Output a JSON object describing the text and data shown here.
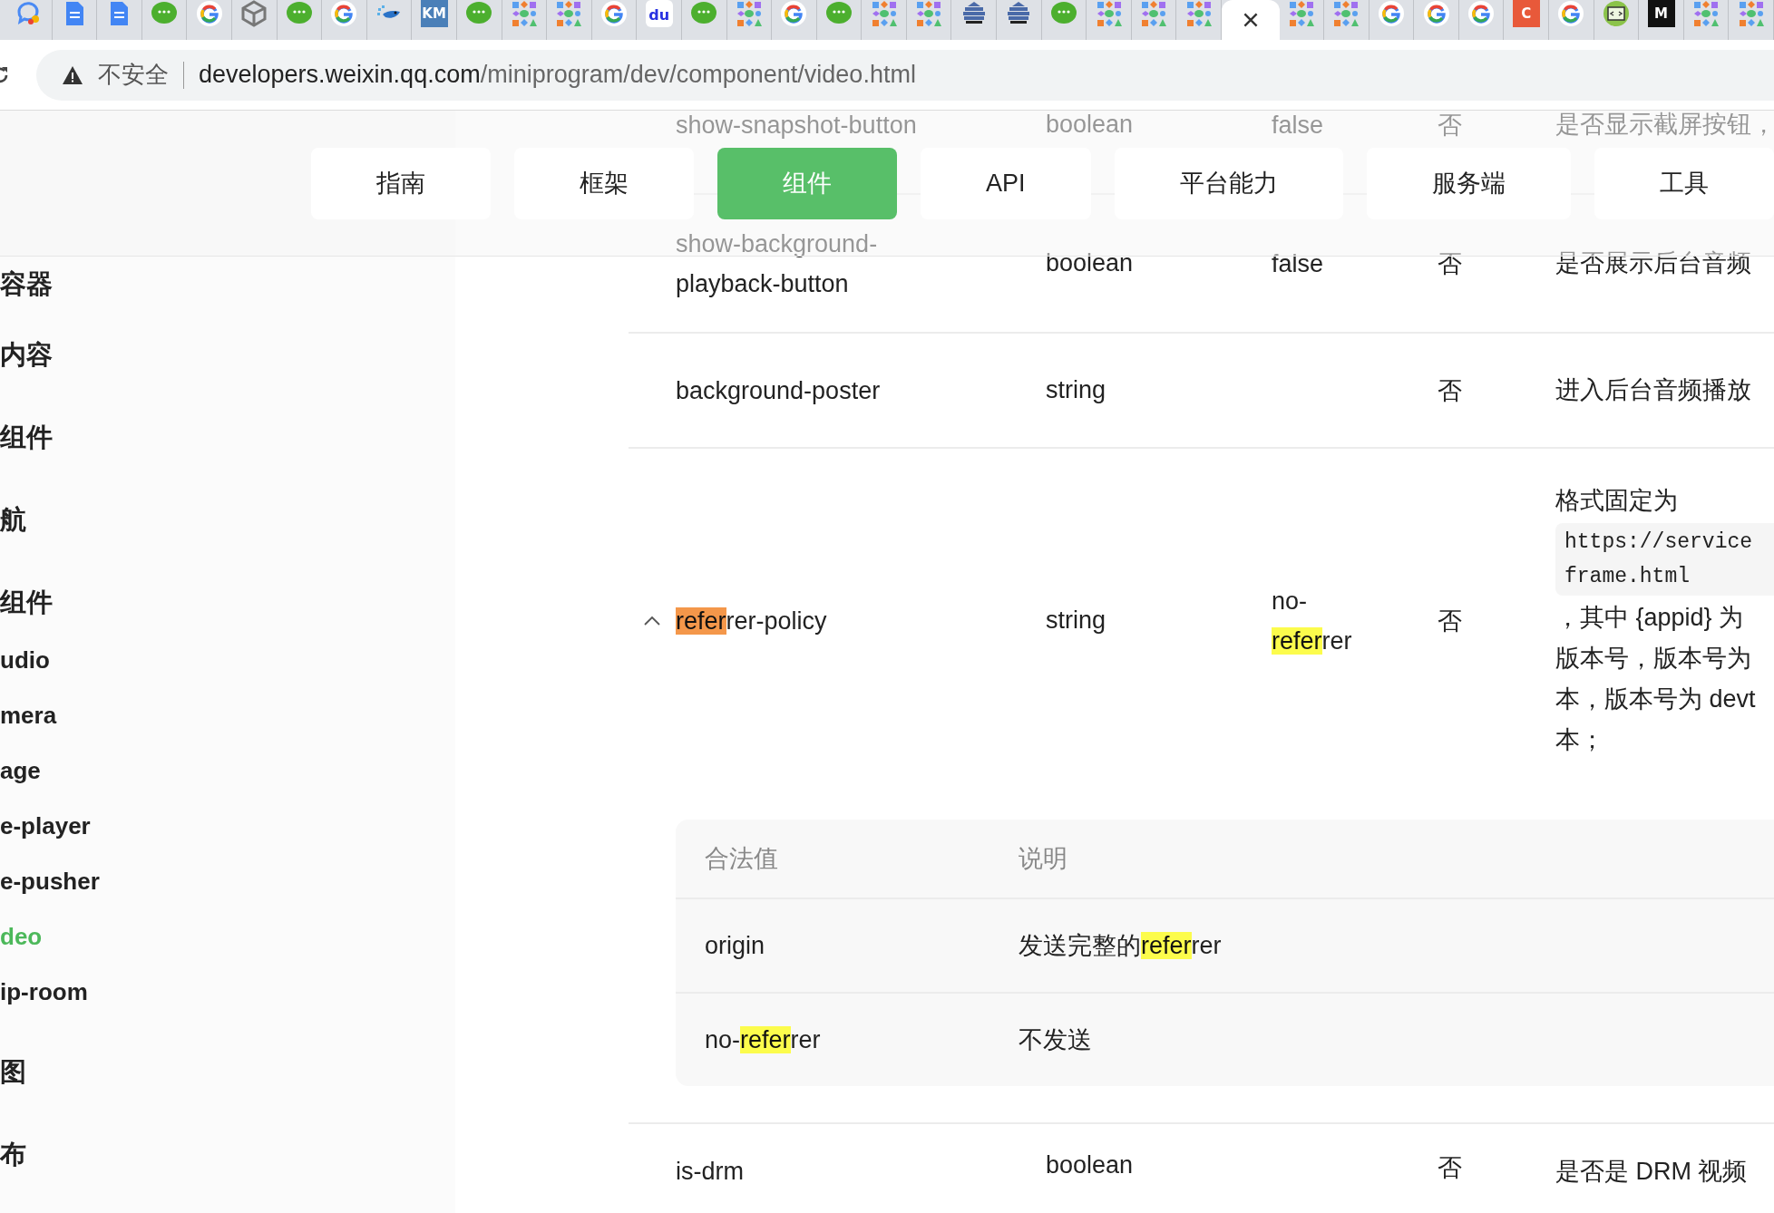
{
  "browser": {
    "tabs": [
      {
        "kind": "chat",
        "selected": false
      },
      {
        "kind": "doc",
        "selected": false
      },
      {
        "kind": "doc",
        "selected": false
      },
      {
        "kind": "wechat",
        "selected": false
      },
      {
        "kind": "google",
        "selected": false
      },
      {
        "kind": "cube",
        "selected": false
      },
      {
        "kind": "wechat",
        "selected": false
      },
      {
        "kind": "google",
        "selected": false
      },
      {
        "kind": "bird",
        "selected": false
      },
      {
        "kind": "tile",
        "mark": "KM",
        "color": "#4a7fb8",
        "selected": false
      },
      {
        "kind": "wechat",
        "selected": false
      },
      {
        "kind": "shapes",
        "selected": false
      },
      {
        "kind": "shapes",
        "selected": false
      },
      {
        "kind": "google",
        "selected": false
      },
      {
        "kind": "paw",
        "mark": "du",
        "selected": false
      },
      {
        "kind": "wechat",
        "selected": false
      },
      {
        "kind": "shapes",
        "selected": false
      },
      {
        "kind": "google",
        "selected": false
      },
      {
        "kind": "wechat",
        "selected": false
      },
      {
        "kind": "shapes",
        "selected": false
      },
      {
        "kind": "shapes",
        "selected": false
      },
      {
        "kind": "stack",
        "selected": false
      },
      {
        "kind": "stack",
        "selected": false
      },
      {
        "kind": "wechat",
        "selected": false
      },
      {
        "kind": "shapes",
        "selected": false
      },
      {
        "kind": "shapes",
        "selected": false
      },
      {
        "kind": "shapes",
        "selected": false
      },
      {
        "selected": true
      },
      {
        "kind": "shapes",
        "selected": false
      },
      {
        "kind": "shapes",
        "selected": false
      },
      {
        "kind": "google",
        "selected": false
      },
      {
        "kind": "google",
        "selected": false
      },
      {
        "kind": "google",
        "selected": false
      },
      {
        "kind": "tile",
        "mark": "C",
        "color": "#e8593a",
        "selected": false
      },
      {
        "kind": "google",
        "selected": false
      },
      {
        "kind": "code",
        "selected": false
      },
      {
        "kind": "tile",
        "mark": "M",
        "color": "#111111",
        "selected": false
      },
      {
        "kind": "shapes",
        "selected": false
      },
      {
        "kind": "shapes",
        "selected": false
      }
    ],
    "address": {
      "security": "不安全",
      "host": "developers.weixin.qq.com",
      "path": "/miniprogram/dev/component/video.html"
    }
  },
  "nav": [
    {
      "label": "指南",
      "selected": false
    },
    {
      "label": "框架",
      "selected": false
    },
    {
      "label": "组件",
      "selected": true
    },
    {
      "label": "API",
      "selected": false
    },
    {
      "label": "平台能力",
      "selected": false
    },
    {
      "label": "服务端",
      "selected": false
    },
    {
      "label": "工具",
      "selected": false
    }
  ],
  "sidebar": {
    "items": [
      {
        "label": "容器",
        "kind": "section",
        "selected": false
      },
      {
        "label": "内容",
        "kind": "section",
        "selected": false
      },
      {
        "label": "组件",
        "kind": "section",
        "selected": false
      },
      {
        "label": "航",
        "kind": "section",
        "selected": false
      },
      {
        "label": "组件",
        "kind": "section",
        "selected": false
      },
      {
        "label": "udio",
        "kind": "item",
        "selected": false
      },
      {
        "label": "mera",
        "kind": "item",
        "selected": false
      },
      {
        "label": "age",
        "kind": "item",
        "selected": false
      },
      {
        "label": "e-player",
        "kind": "item",
        "selected": false
      },
      {
        "label": "e-pusher",
        "kind": "item",
        "selected": false
      },
      {
        "label": "deo",
        "kind": "item",
        "selected": true
      },
      {
        "label": "ip-room",
        "kind": "item",
        "selected": false
      },
      {
        "label": "图",
        "kind": "section",
        "selected": false
      },
      {
        "label": "布",
        "kind": "section",
        "selected": false
      }
    ]
  },
  "table": {
    "rows": [
      {
        "name": [
          {
            "text": "show-snapshot-button"
          }
        ],
        "type": "boolean",
        "default": [
          {
            "text": "false"
          }
        ],
        "required": "否",
        "description": [
          {
            "kind": "text",
            "text": "是否显示截屏按钮，"
          }
        ]
      },
      {
        "name": [
          {
            "text": "show-background-playback-button"
          }
        ],
        "type": "boolean",
        "default": [
          {
            "text": "false"
          }
        ],
        "required": "否",
        "description": [
          {
            "kind": "text",
            "text": "是否展示后台音频"
          }
        ]
      },
      {
        "name": [
          {
            "text": "background-poster"
          }
        ],
        "type": "string",
        "required": "否",
        "description": [
          {
            "kind": "text",
            "text": "进入后台音频播放"
          }
        ]
      },
      {
        "expanded": true,
        "name": [
          {
            "text": "refer",
            "highlighted": true,
            "current": true
          },
          {
            "text": "rer-policy"
          }
        ],
        "type": "string",
        "default": [
          {
            "text": "no-"
          },
          {
            "text": "refer",
            "highlighted": true,
            "current": false
          },
          {
            "text": "rer"
          }
        ],
        "required": "否",
        "description": [
          {
            "kind": "text",
            "text": "格式固定为"
          },
          {
            "kind": "code",
            "lines": [
              "https://service",
              "frame.html"
            ]
          },
          {
            "kind": "text",
            "text": "，其中 {appid} 为"
          },
          {
            "kind": "text",
            "text": "版本号，版本号为"
          },
          {
            "kind": "text",
            "text": "本，版本号为 devt"
          },
          {
            "kind": "text",
            "text": "本；"
          }
        ],
        "values": {
          "columns": [
            "合法值",
            "说明"
          ],
          "rows": [
            {
              "value": [
                {
                  "text": "origin"
                }
              ],
              "description": [
                {
                  "text": "发送完整的"
                },
                {
                  "text": "refer",
                  "highlighted": true,
                  "current": false
                },
                {
                  "text": "rer"
                }
              ]
            },
            {
              "value": [
                {
                  "text": "no-"
                },
                {
                  "text": "refer",
                  "highlighted": true,
                  "current": false
                },
                {
                  "text": "rer"
                }
              ],
              "description": [
                {
                  "text": "不发送"
                }
              ]
            }
          ]
        }
      },
      {
        "name": [
          {
            "text": "is-drm"
          }
        ],
        "type": "boolean",
        "required": "否",
        "description": [
          {
            "kind": "text",
            "text": "是否是 DRM 视频"
          }
        ]
      }
    ]
  }
}
